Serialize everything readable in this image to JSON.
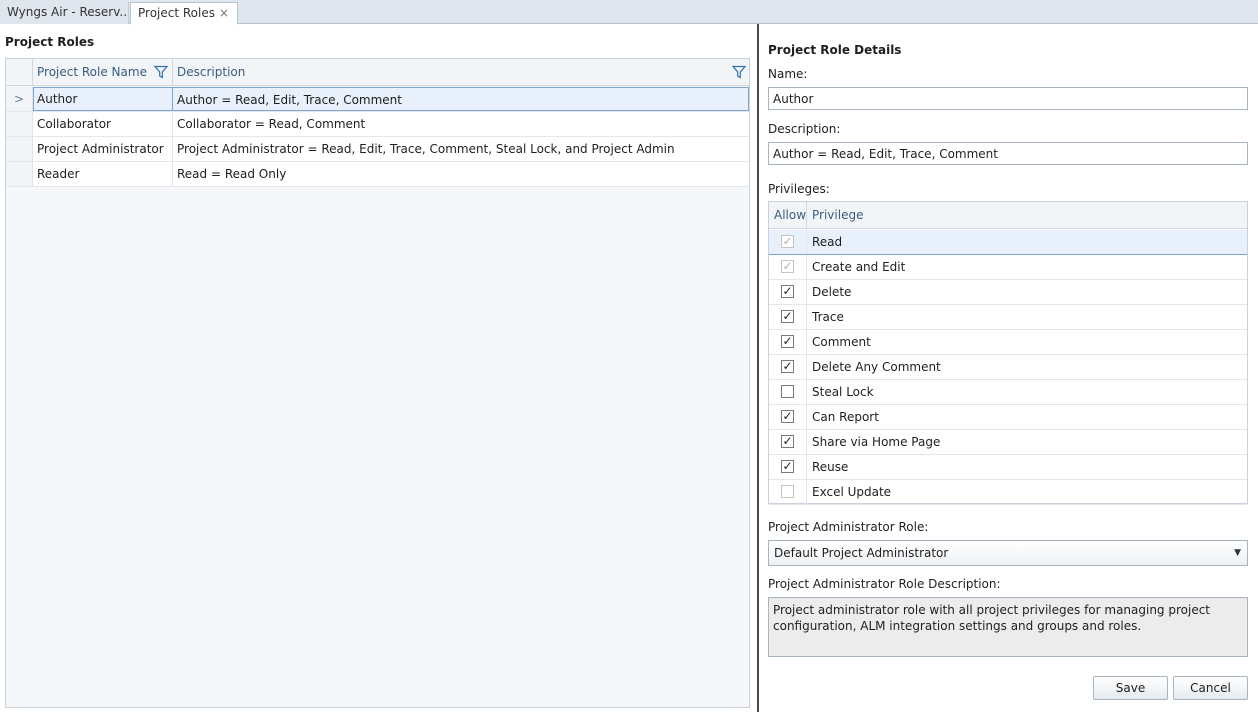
{
  "tabs": [
    {
      "label": "Wyngs Air - Reserv..."
    },
    {
      "label": "Project Roles",
      "close": "×"
    }
  ],
  "roles_panel": {
    "title": "Project Roles",
    "columns": {
      "name": "Project Role Name",
      "description": "Description"
    },
    "selected_marker": ">",
    "rows": [
      {
        "name": "Author",
        "description": "Author = Read, Edit, Trace, Comment"
      },
      {
        "name": "Collaborator",
        "description": "Collaborator = Read, Comment"
      },
      {
        "name": "Project Administrator",
        "description": "Project Administrator = Read, Edit, Trace, Comment, Steal Lock, and Project Admin"
      },
      {
        "name": "Reader",
        "description": "Read = Read Only"
      }
    ]
  },
  "details": {
    "title": "Project Role Details",
    "name_label": "Name:",
    "name_value": "Author",
    "description_label": "Description:",
    "description_value": "Author = Read, Edit, Trace, Comment",
    "privileges_label": "Privileges:",
    "privileges_columns": {
      "allow": "Allow",
      "privilege": "Privilege"
    },
    "privileges": [
      {
        "name": "Read",
        "checked": "✓",
        "state": "disabled-checked"
      },
      {
        "name": "Create and Edit",
        "checked": "✓",
        "state": "disabled-checked"
      },
      {
        "name": "Delete",
        "checked": "✓",
        "state": "checked"
      },
      {
        "name": "Trace",
        "checked": "✓",
        "state": "checked"
      },
      {
        "name": "Comment",
        "checked": "✓",
        "state": "checked"
      },
      {
        "name": "Delete Any Comment",
        "checked": "✓",
        "state": "checked"
      },
      {
        "name": "Steal Lock",
        "checked": "",
        "state": "unchecked"
      },
      {
        "name": "Can Report",
        "checked": "✓",
        "state": "checked"
      },
      {
        "name": "Share via Home Page",
        "checked": "✓",
        "state": "checked"
      },
      {
        "name": "Reuse",
        "checked": "✓",
        "state": "checked"
      },
      {
        "name": "Excel Update",
        "checked": "",
        "state": "disabled-unchecked"
      }
    ],
    "admin_role_label": "Project Administrator Role:",
    "admin_role_value": "Default Project Administrator",
    "admin_role_desc_label": "Project Administrator Role Description:",
    "admin_role_desc_value": "Project administrator role with all project privileges for managing project configuration, ALM integration settings and groups and roles.",
    "save_label": "Save",
    "cancel_label": "Cancel"
  }
}
